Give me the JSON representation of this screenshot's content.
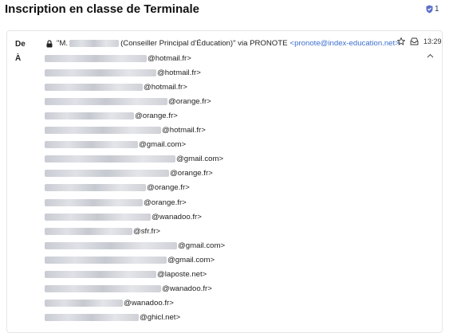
{
  "title": "Inscription en classe de Terminale",
  "badge": {
    "icon": "shield-icon",
    "count": "1",
    "color": "#5b6fc9"
  },
  "message": {
    "from_label": "De",
    "to_label": "À",
    "sender": {
      "icon": "lock-icon",
      "prefix": "\"M.",
      "suffix": "(Conseiller Principal d'Éducation)\" via PRONOTE",
      "email": "<pronote@index-education.net>",
      "email_color": "#3c6fcf"
    },
    "time": "13:29",
    "recipients": [
      "@hotmail.fr>",
      "@hotmail.fr>",
      "@hotmail.fr>",
      "@orange.fr>",
      "@orange.fr>",
      "@hotmail.fr>",
      "@gmail.com>",
      "@gmail.com>",
      "@orange.fr>",
      "@orange.fr>",
      "@orange.fr>",
      "@wanadoo.fr>",
      "@sfr.fr>",
      "@gmail.com>",
      "@gmail.com>",
      "@laposte.net>",
      "@wanadoo.fr>",
      "@wanadoo.fr>",
      "@ghicl.net>"
    ]
  }
}
